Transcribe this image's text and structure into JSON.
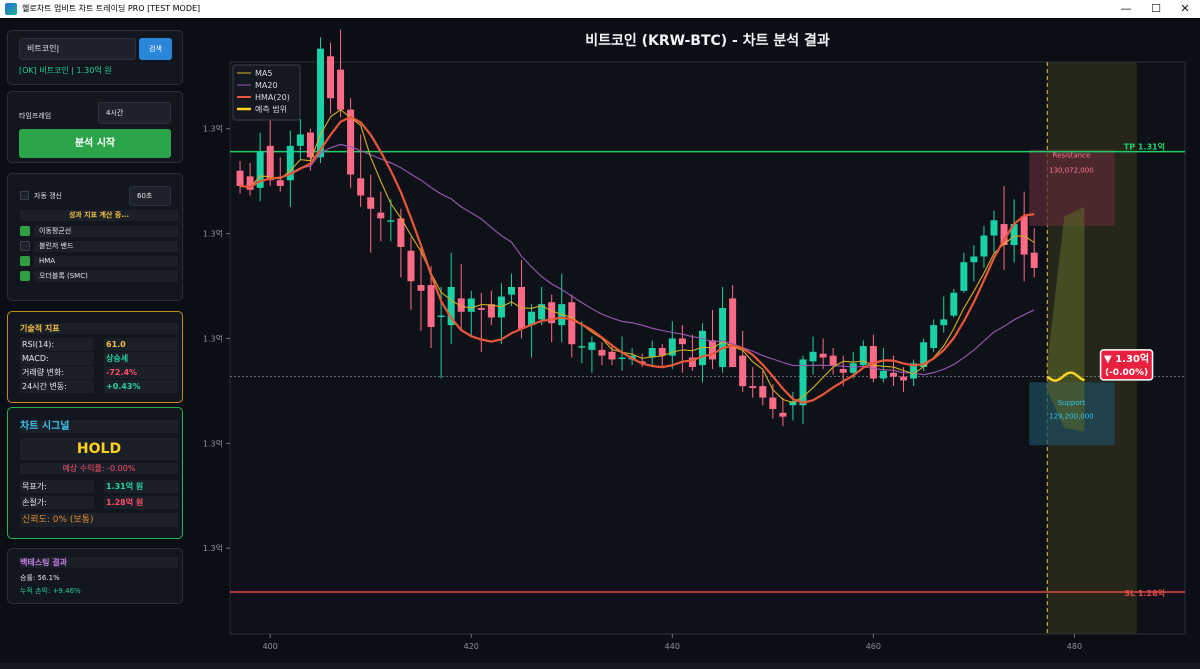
{
  "window": {
    "title": "헬로차트 업비트 차트 트레이딩 PRO [TEST MODE]",
    "minimize": "—",
    "maximize": "☐",
    "close": "✕"
  },
  "search": {
    "value": "비트코인|",
    "button": "검색",
    "status": "[OK] 비트코인 | 1.30억 원"
  },
  "timeframe": {
    "label": "타임프레임",
    "value": "4시간",
    "start_button": "분석 시작"
  },
  "auto": {
    "label": "자동 갱신",
    "interval": "60초",
    "status": "성과 지표 계산 중..."
  },
  "indicators": [
    {
      "label": "이동평균선",
      "checked": true
    },
    {
      "label": "볼린저 밴드",
      "checked": false
    },
    {
      "label": "HMA",
      "checked": true
    },
    {
      "label": "오더블록 (SMC)",
      "checked": true
    }
  ],
  "tech": {
    "title": "기술적 지표",
    "rows": [
      {
        "k": "RSI(14):",
        "v": "61.0",
        "color": "#f5c242"
      },
      {
        "k": "MACD:",
        "v": "상승세",
        "color": "#29d3a2"
      },
      {
        "k": "거래량 변화:",
        "v": "-72.4%",
        "color": "#ff4d6a"
      },
      {
        "k": "24시간 변동:",
        "v": "+0.43%",
        "color": "#29d3a2"
      }
    ]
  },
  "signal": {
    "title": "차트 시그널",
    "value": "HOLD",
    "expected": "예상 수익률: -0.00%",
    "target_k": "목표가:",
    "target_v": "1.31억 원",
    "stop_k": "손절가:",
    "stop_v": "1.28억 원",
    "confidence": "신뢰도: 0% (보통)"
  },
  "backtest": {
    "title": "백테스팅 결과",
    "win": "승률: 56.1%",
    "pnl": "누적 손익: +9.46%"
  },
  "chart_title": "비트코인 (KRW-BTC) - 차트 분석 결과",
  "chart_data": {
    "type": "candlestick",
    "x_ticks": [
      400,
      420,
      440,
      460,
      480
    ],
    "y_ticks": [
      "1.3억",
      "1.3억",
      "1.3억",
      "1.3억",
      "1.3억"
    ],
    "legend": [
      "MA5",
      "MA20",
      "HMA(20)",
      "예측 범위"
    ],
    "colors": {
      "up": "#1ad1a5",
      "down": "#ff6b86",
      "ma5": "#d4b024",
      "ma20": "#9b59b6",
      "hma": "#e8573a",
      "pred": "#ffd21f",
      "tp": "#1fd068",
      "sl": "#e04848"
    },
    "tp_label": "TP 1.31억",
    "sl_label": "SL 1.28억",
    "resistance": {
      "label": "Resistance",
      "value": "130,072,000"
    },
    "support": {
      "label": "Support",
      "value": "129,200,000"
    },
    "badge": {
      "line1": "▼ 1.30억",
      "line2": "(-0.00%)"
    },
    "x_min": 396,
    "x_max": 491,
    "y_min": 128460000,
    "y_max": 131460000,
    "tp_value": 130990000,
    "sl_value": 128680000,
    "current_value": 129810000,
    "forecast_start": 477.3,
    "forecast_end": 486.2,
    "candles_ohlc": [
      [
        397,
        130890000,
        130940000,
        130770000,
        130810000
      ],
      [
        398,
        130860000,
        130930000,
        130760000,
        130790000
      ],
      [
        399,
        130800000,
        131090000,
        130730000,
        130990000
      ],
      [
        400,
        131020000,
        131200000,
        130810000,
        130840000
      ],
      [
        401,
        130840000,
        130960000,
        130780000,
        130810000
      ],
      [
        402,
        130840000,
        131100000,
        130700000,
        131020000
      ],
      [
        403,
        131020000,
        131160000,
        130950000,
        131080000
      ],
      [
        404,
        131090000,
        131110000,
        130890000,
        130960000
      ],
      [
        405,
        130960000,
        131590000,
        130930000,
        131530000
      ],
      [
        406,
        131490000,
        131560000,
        131190000,
        131270000
      ],
      [
        407,
        131420000,
        131630000,
        131170000,
        131210000
      ],
      [
        408,
        131210000,
        131270000,
        130800000,
        130870000
      ],
      [
        409,
        130850000,
        131080000,
        130700000,
        130760000
      ],
      [
        410,
        130750000,
        130870000,
        130460000,
        130690000
      ],
      [
        411,
        130670000,
        130780000,
        130520000,
        130640000
      ],
      [
        412,
        130630000,
        130740000,
        130520000,
        130630000
      ],
      [
        413,
        130640000,
        130690000,
        130330000,
        130490000
      ],
      [
        414,
        130470000,
        130540000,
        130160000,
        130310000
      ],
      [
        415,
        130290000,
        130510000,
        130050000,
        130260000
      ],
      [
        416,
        130290000,
        130390000,
        129960000,
        130070000
      ],
      [
        417,
        130130000,
        130280000,
        129800000,
        130130000
      ],
      [
        418,
        130080000,
        130460000,
        129980000,
        130280000
      ],
      [
        419,
        130220000,
        130400000,
        130060000,
        130150000
      ],
      [
        420,
        130150000,
        130260000,
        130020000,
        130220000
      ],
      [
        421,
        130170000,
        130250000,
        129940000,
        130160000
      ],
      [
        422,
        130190000,
        130260000,
        130080000,
        130120000
      ],
      [
        423,
        130120000,
        130300000,
        129980000,
        130230000
      ],
      [
        424,
        130240000,
        130350000,
        130180000,
        130280000
      ],
      [
        425,
        130280000,
        130420000,
        130010000,
        130060000
      ],
      [
        426,
        130080000,
        130190000,
        129910000,
        130150000
      ],
      [
        427,
        130110000,
        130280000,
        130080000,
        130190000
      ],
      [
        428,
        130200000,
        130240000,
        129990000,
        130090000
      ],
      [
        429,
        130080000,
        130350000,
        129990000,
        130190000
      ],
      [
        430,
        130200000,
        130240000,
        129910000,
        129980000
      ],
      [
        431,
        129970000,
        130100000,
        129880000,
        129970000
      ],
      [
        432,
        129950000,
        130020000,
        129830000,
        129990000
      ],
      [
        433,
        129950000,
        129990000,
        129870000,
        129920000
      ],
      [
        434,
        129940000,
        129980000,
        129870000,
        129900000
      ],
      [
        435,
        129910000,
        130020000,
        129840000,
        129910000
      ],
      [
        436,
        129900000,
        129960000,
        129870000,
        129920000
      ],
      [
        437,
        129890000,
        129930000,
        129860000,
        129880000
      ],
      [
        438,
        129910000,
        130000000,
        129860000,
        129960000
      ],
      [
        439,
        129960000,
        129980000,
        129860000,
        129920000
      ],
      [
        440,
        129920000,
        130100000,
        129850000,
        130010000
      ],
      [
        441,
        130010000,
        130080000,
        129830000,
        129980000
      ],
      [
        442,
        129910000,
        130030000,
        129840000,
        129860000
      ],
      [
        443,
        129870000,
        130090000,
        129780000,
        130050000
      ],
      [
        444,
        130000000,
        130160000,
        129850000,
        129900000
      ],
      [
        445,
        129860000,
        130280000,
        129830000,
        130170000
      ],
      [
        446,
        130220000,
        130290000,
        129860000,
        129860000
      ],
      [
        447,
        129920000,
        130050000,
        129730000,
        129760000
      ],
      [
        448,
        129760000,
        129860000,
        129700000,
        129750000
      ],
      [
        449,
        129760000,
        129840000,
        129660000,
        129700000
      ],
      [
        450,
        129700000,
        129770000,
        129590000,
        129640000
      ],
      [
        451,
        129620000,
        129700000,
        129550000,
        129600000
      ],
      [
        452,
        129660000,
        129730000,
        129580000,
        129680000
      ],
      [
        453,
        129660000,
        129920000,
        129560000,
        129900000
      ],
      [
        454,
        129890000,
        130020000,
        129820000,
        129940000
      ],
      [
        455,
        129930000,
        130010000,
        129850000,
        129910000
      ],
      [
        456,
        129920000,
        129960000,
        129820000,
        129870000
      ],
      [
        457,
        129850000,
        129920000,
        129760000,
        129830000
      ],
      [
        458,
        129830000,
        129940000,
        129800000,
        129880000
      ],
      [
        459,
        129870000,
        130000000,
        129860000,
        129970000
      ],
      [
        460,
        129970000,
        130030000,
        129780000,
        129800000
      ],
      [
        461,
        129800000,
        129960000,
        129780000,
        129840000
      ],
      [
        462,
        129830000,
        129920000,
        129760000,
        129810000
      ],
      [
        463,
        129810000,
        129860000,
        129730000,
        129790000
      ],
      [
        464,
        129800000,
        129900000,
        129760000,
        129880000
      ],
      [
        465,
        129860000,
        130010000,
        129840000,
        129990000
      ],
      [
        466,
        129960000,
        130110000,
        129940000,
        130080000
      ],
      [
        467,
        130080000,
        130230000,
        130040000,
        130110000
      ],
      [
        468,
        130130000,
        130270000,
        130120000,
        130250000
      ],
      [
        469,
        130260000,
        130460000,
        130250000,
        130410000
      ],
      [
        470,
        130410000,
        130500000,
        130310000,
        130440000
      ],
      [
        471,
        130440000,
        130600000,
        130380000,
        130550000
      ],
      [
        472,
        130550000,
        130680000,
        130460000,
        130630000
      ],
      [
        473,
        130610000,
        130810000,
        130370000,
        130500000
      ],
      [
        474,
        130500000,
        130740000,
        130410000,
        130610000
      ],
      [
        475,
        130650000,
        130780000,
        130310000,
        130450000
      ],
      [
        476,
        130460000,
        130590000,
        130330000,
        130380000
      ]
    ]
  }
}
